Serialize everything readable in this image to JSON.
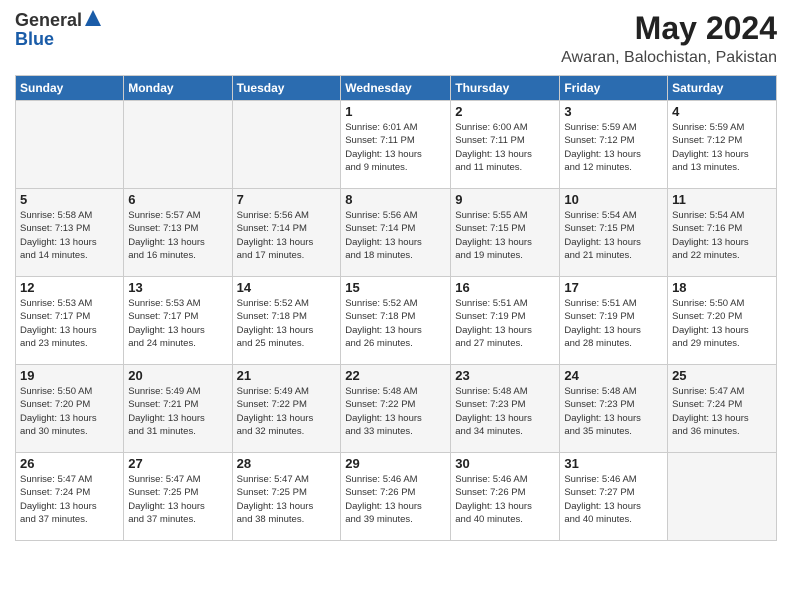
{
  "logo": {
    "general": "General",
    "blue": "Blue"
  },
  "header": {
    "month_title": "May 2024",
    "location": "Awaran, Balochistan, Pakistan"
  },
  "weekdays": [
    "Sunday",
    "Monday",
    "Tuesday",
    "Wednesday",
    "Thursday",
    "Friday",
    "Saturday"
  ],
  "weeks": [
    [
      {
        "day": "",
        "info": ""
      },
      {
        "day": "",
        "info": ""
      },
      {
        "day": "",
        "info": ""
      },
      {
        "day": "1",
        "info": "Sunrise: 6:01 AM\nSunset: 7:11 PM\nDaylight: 13 hours\nand 9 minutes."
      },
      {
        "day": "2",
        "info": "Sunrise: 6:00 AM\nSunset: 7:11 PM\nDaylight: 13 hours\nand 11 minutes."
      },
      {
        "day": "3",
        "info": "Sunrise: 5:59 AM\nSunset: 7:12 PM\nDaylight: 13 hours\nand 12 minutes."
      },
      {
        "day": "4",
        "info": "Sunrise: 5:59 AM\nSunset: 7:12 PM\nDaylight: 13 hours\nand 13 minutes."
      }
    ],
    [
      {
        "day": "5",
        "info": "Sunrise: 5:58 AM\nSunset: 7:13 PM\nDaylight: 13 hours\nand 14 minutes."
      },
      {
        "day": "6",
        "info": "Sunrise: 5:57 AM\nSunset: 7:13 PM\nDaylight: 13 hours\nand 16 minutes."
      },
      {
        "day": "7",
        "info": "Sunrise: 5:56 AM\nSunset: 7:14 PM\nDaylight: 13 hours\nand 17 minutes."
      },
      {
        "day": "8",
        "info": "Sunrise: 5:56 AM\nSunset: 7:14 PM\nDaylight: 13 hours\nand 18 minutes."
      },
      {
        "day": "9",
        "info": "Sunrise: 5:55 AM\nSunset: 7:15 PM\nDaylight: 13 hours\nand 19 minutes."
      },
      {
        "day": "10",
        "info": "Sunrise: 5:54 AM\nSunset: 7:15 PM\nDaylight: 13 hours\nand 21 minutes."
      },
      {
        "day": "11",
        "info": "Sunrise: 5:54 AM\nSunset: 7:16 PM\nDaylight: 13 hours\nand 22 minutes."
      }
    ],
    [
      {
        "day": "12",
        "info": "Sunrise: 5:53 AM\nSunset: 7:17 PM\nDaylight: 13 hours\nand 23 minutes."
      },
      {
        "day": "13",
        "info": "Sunrise: 5:53 AM\nSunset: 7:17 PM\nDaylight: 13 hours\nand 24 minutes."
      },
      {
        "day": "14",
        "info": "Sunrise: 5:52 AM\nSunset: 7:18 PM\nDaylight: 13 hours\nand 25 minutes."
      },
      {
        "day": "15",
        "info": "Sunrise: 5:52 AM\nSunset: 7:18 PM\nDaylight: 13 hours\nand 26 minutes."
      },
      {
        "day": "16",
        "info": "Sunrise: 5:51 AM\nSunset: 7:19 PM\nDaylight: 13 hours\nand 27 minutes."
      },
      {
        "day": "17",
        "info": "Sunrise: 5:51 AM\nSunset: 7:19 PM\nDaylight: 13 hours\nand 28 minutes."
      },
      {
        "day": "18",
        "info": "Sunrise: 5:50 AM\nSunset: 7:20 PM\nDaylight: 13 hours\nand 29 minutes."
      }
    ],
    [
      {
        "day": "19",
        "info": "Sunrise: 5:50 AM\nSunset: 7:20 PM\nDaylight: 13 hours\nand 30 minutes."
      },
      {
        "day": "20",
        "info": "Sunrise: 5:49 AM\nSunset: 7:21 PM\nDaylight: 13 hours\nand 31 minutes."
      },
      {
        "day": "21",
        "info": "Sunrise: 5:49 AM\nSunset: 7:22 PM\nDaylight: 13 hours\nand 32 minutes."
      },
      {
        "day": "22",
        "info": "Sunrise: 5:48 AM\nSunset: 7:22 PM\nDaylight: 13 hours\nand 33 minutes."
      },
      {
        "day": "23",
        "info": "Sunrise: 5:48 AM\nSunset: 7:23 PM\nDaylight: 13 hours\nand 34 minutes."
      },
      {
        "day": "24",
        "info": "Sunrise: 5:48 AM\nSunset: 7:23 PM\nDaylight: 13 hours\nand 35 minutes."
      },
      {
        "day": "25",
        "info": "Sunrise: 5:47 AM\nSunset: 7:24 PM\nDaylight: 13 hours\nand 36 minutes."
      }
    ],
    [
      {
        "day": "26",
        "info": "Sunrise: 5:47 AM\nSunset: 7:24 PM\nDaylight: 13 hours\nand 37 minutes."
      },
      {
        "day": "27",
        "info": "Sunrise: 5:47 AM\nSunset: 7:25 PM\nDaylight: 13 hours\nand 37 minutes."
      },
      {
        "day": "28",
        "info": "Sunrise: 5:47 AM\nSunset: 7:25 PM\nDaylight: 13 hours\nand 38 minutes."
      },
      {
        "day": "29",
        "info": "Sunrise: 5:46 AM\nSunset: 7:26 PM\nDaylight: 13 hours\nand 39 minutes."
      },
      {
        "day": "30",
        "info": "Sunrise: 5:46 AM\nSunset: 7:26 PM\nDaylight: 13 hours\nand 40 minutes."
      },
      {
        "day": "31",
        "info": "Sunrise: 5:46 AM\nSunset: 7:27 PM\nDaylight: 13 hours\nand 40 minutes."
      },
      {
        "day": "",
        "info": ""
      }
    ]
  ]
}
